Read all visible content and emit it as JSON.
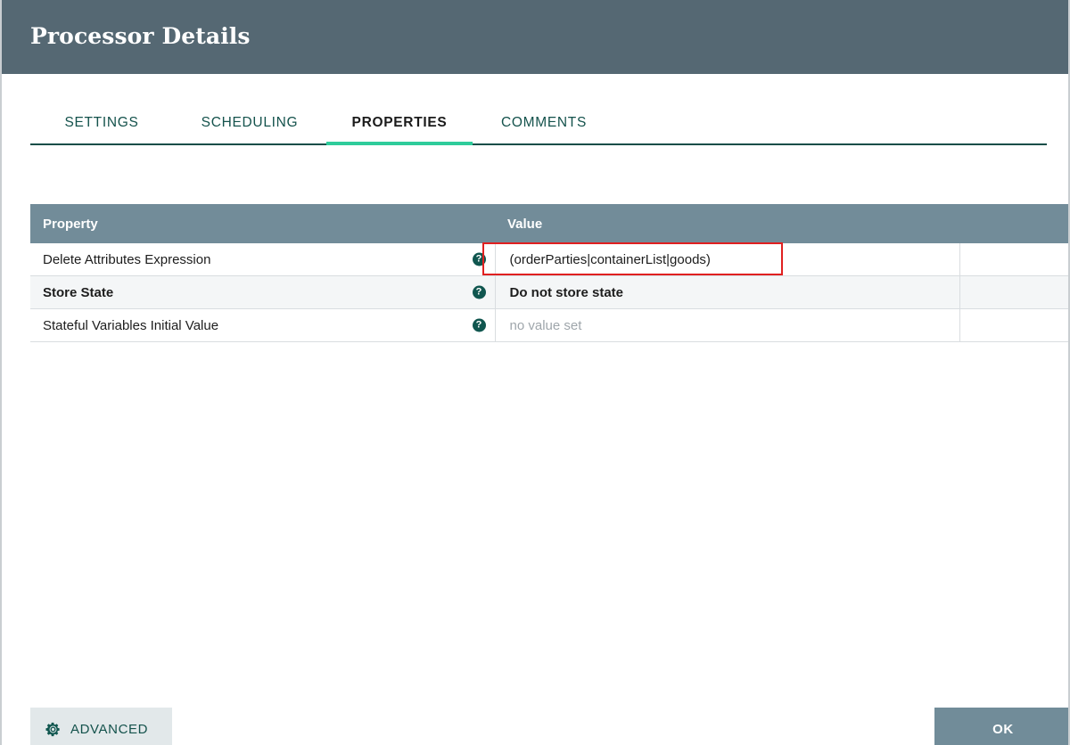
{
  "window": {
    "title": "Processor Details",
    "header_bg": "#556873"
  },
  "tabs": [
    {
      "label": "SETTINGS",
      "active": false
    },
    {
      "label": "SCHEDULING",
      "active": false
    },
    {
      "label": "PROPERTIES",
      "active": true
    },
    {
      "label": "COMMENTS",
      "active": false
    }
  ],
  "tab_accent_color": "#2ecc9b",
  "table": {
    "header_bg": "#728c99",
    "columns": [
      "Property",
      "Value",
      ""
    ],
    "rows": [
      {
        "property": "Delete Attributes Expression",
        "help": "?",
        "value": "(orderParties|containerList|goods)",
        "value_style": "normal",
        "highlighted": true
      },
      {
        "property": "Store State",
        "help": "?",
        "value": "Do not store state",
        "value_style": "bold",
        "highlighted": false
      },
      {
        "property": "Stateful Variables Initial Value",
        "help": "?",
        "value": "no value set",
        "value_style": "placeholder",
        "highlighted": false
      }
    ]
  },
  "highlight": {
    "color": "#e02020"
  },
  "footer": {
    "advanced_label": "ADVANCED",
    "advanced_icon": "gear-icon",
    "ok_label": "OK",
    "ok_bg": "#718c99"
  }
}
